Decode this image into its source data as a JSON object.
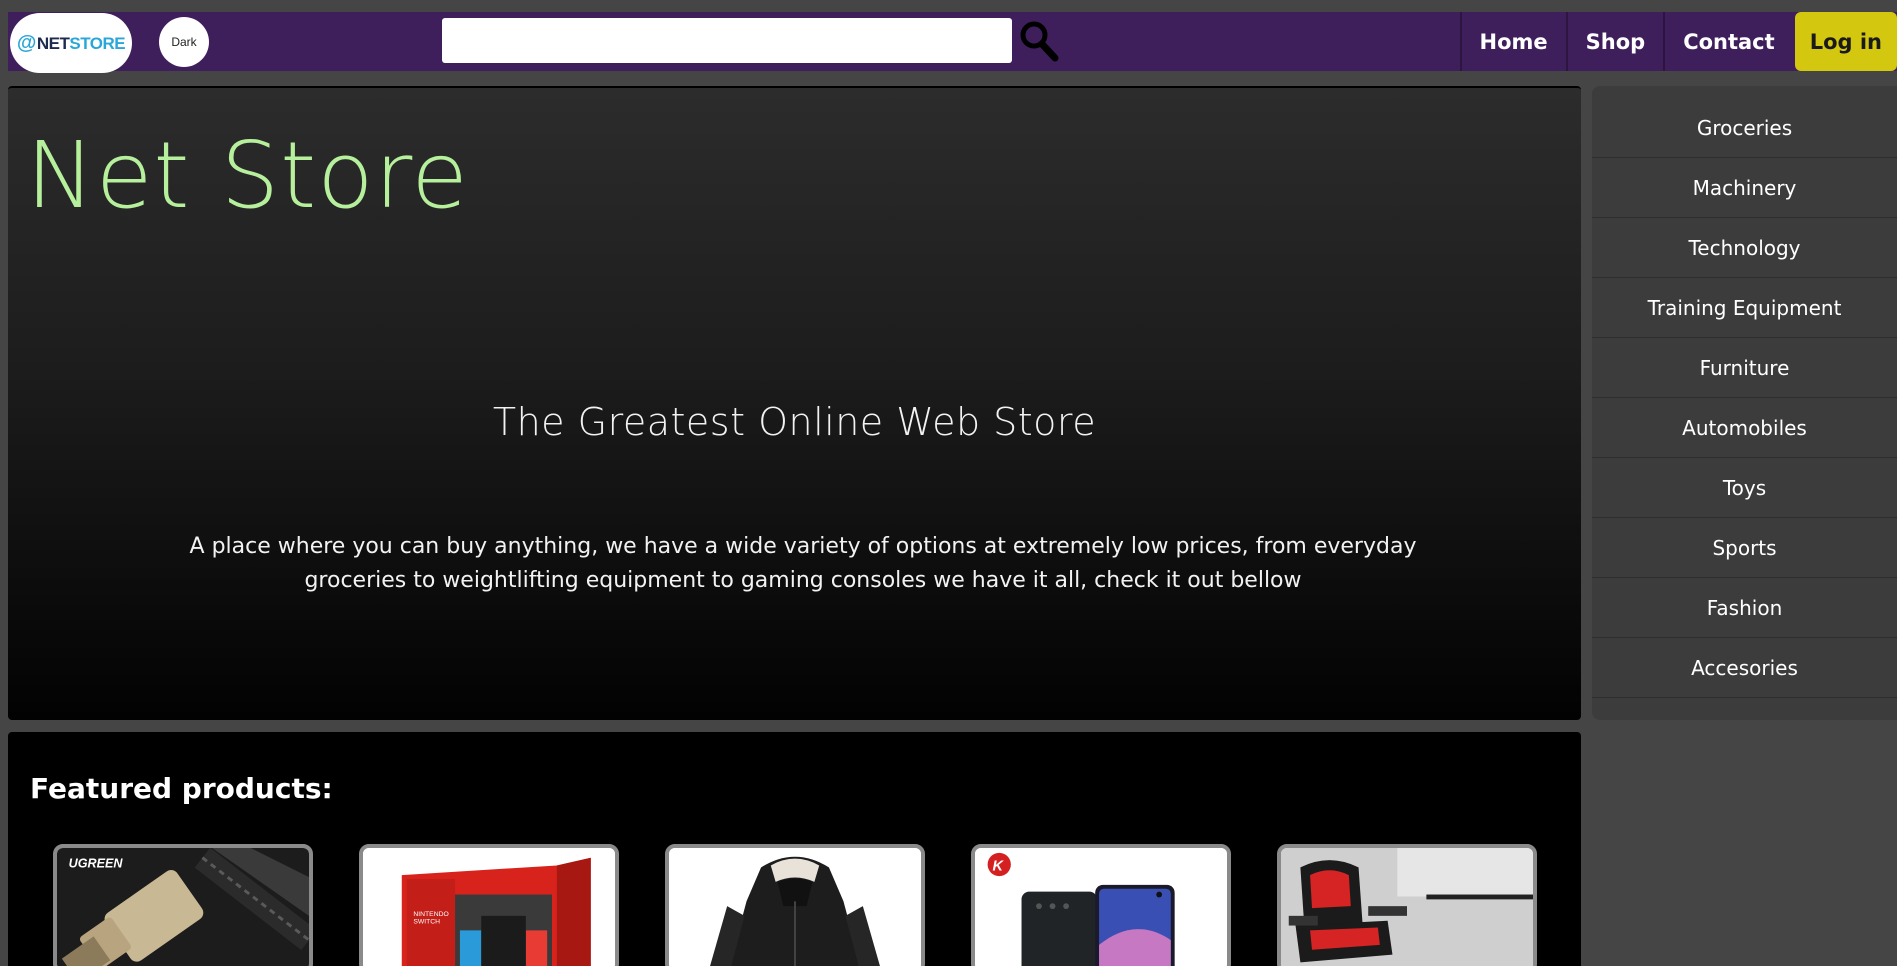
{
  "header": {
    "logo": {
      "at": "@",
      "net": "NET",
      "store": "STORE"
    },
    "theme_toggle_label": "Dark",
    "search": {
      "value": "",
      "placeholder": ""
    },
    "nav": [
      {
        "label": "Home"
      },
      {
        "label": "Shop"
      },
      {
        "label": "Contact"
      }
    ],
    "login_label": "Log in",
    "colors": {
      "bar": "#3e1f5c",
      "login": "#d4c70f"
    }
  },
  "hero": {
    "title": "Net Store",
    "subtitle": "The Greatest Online Web Store",
    "description": "A place where you can buy anything, we have a wide variety of options at extremely low prices, from everyday groceries to weightlifting equipment to gaming consoles we have it all, check it out bellow",
    "title_color": "#b6f09c"
  },
  "sidebar": {
    "categories": [
      {
        "label": "Groceries"
      },
      {
        "label": "Machinery"
      },
      {
        "label": "Technology"
      },
      {
        "label": "Training Equipment"
      },
      {
        "label": "Furniture"
      },
      {
        "label": "Automobiles"
      },
      {
        "label": "Toys"
      },
      {
        "label": "Sports"
      },
      {
        "label": "Fashion"
      },
      {
        "label": "Accesories"
      }
    ]
  },
  "featured": {
    "title": "Featured products:",
    "products": [
      {
        "image": "hdmi-cable-image",
        "brand": "UGREEN"
      },
      {
        "image": "nintendo-switch-box-image",
        "brand": ""
      },
      {
        "image": "black-winter-jacket-image",
        "brand": ""
      },
      {
        "image": "samsung-phone-image",
        "brand": ""
      },
      {
        "image": "gaming-chair-image",
        "brand": ""
      }
    ]
  }
}
